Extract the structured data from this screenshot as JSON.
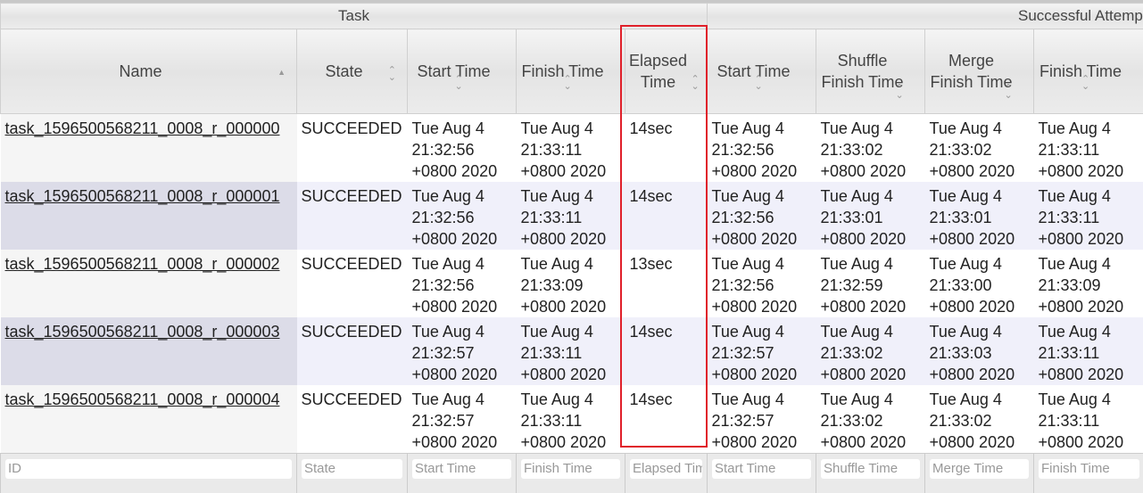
{
  "groups": [
    {
      "label": "Task"
    },
    {
      "label": "Successful Attempt"
    }
  ],
  "columns": [
    {
      "label": "Name",
      "sort": "asc"
    },
    {
      "label": "State",
      "sort": "both"
    },
    {
      "label": "Start Time",
      "sort": "both"
    },
    {
      "label": "Finish Time",
      "sort": "both"
    },
    {
      "label": "Elapsed\nTime",
      "sort": "both"
    },
    {
      "label": "Start Time",
      "sort": "both"
    },
    {
      "label": "Shuffle\nFinish Time",
      "sort": "both"
    },
    {
      "label": "Merge\nFinish Time",
      "sort": "both"
    },
    {
      "label": "Finish Time",
      "sort": "both"
    }
  ],
  "rows": [
    [
      "task_1596500568211_0008_r_000000",
      "SUCCEEDED",
      "Tue Aug 4\n21:32:56\n+0800 2020",
      "Tue Aug 4\n21:33:11\n+0800 2020",
      "14sec",
      "Tue Aug 4\n21:32:56\n+0800 2020",
      "Tue Aug 4\n21:33:02\n+0800 2020",
      "Tue Aug 4\n21:33:02\n+0800 2020",
      "Tue Aug 4\n21:33:11\n+0800 2020"
    ],
    [
      "task_1596500568211_0008_r_000001",
      "SUCCEEDED",
      "Tue Aug 4\n21:32:56\n+0800 2020",
      "Tue Aug 4\n21:33:11\n+0800 2020",
      "14sec",
      "Tue Aug 4\n21:32:56\n+0800 2020",
      "Tue Aug 4\n21:33:01\n+0800 2020",
      "Tue Aug 4\n21:33:01\n+0800 2020",
      "Tue Aug 4\n21:33:11\n+0800 2020"
    ],
    [
      "task_1596500568211_0008_r_000002",
      "SUCCEEDED",
      "Tue Aug 4\n21:32:56\n+0800 2020",
      "Tue Aug 4\n21:33:09\n+0800 2020",
      "13sec",
      "Tue Aug 4\n21:32:56\n+0800 2020",
      "Tue Aug 4\n21:32:59\n+0800 2020",
      "Tue Aug 4\n21:33:00\n+0800 2020",
      "Tue Aug 4\n21:33:09\n+0800 2020"
    ],
    [
      "task_1596500568211_0008_r_000003",
      "SUCCEEDED",
      "Tue Aug 4\n21:32:57\n+0800 2020",
      "Tue Aug 4\n21:33:11\n+0800 2020",
      "14sec",
      "Tue Aug 4\n21:32:57\n+0800 2020",
      "Tue Aug 4\n21:33:02\n+0800 2020",
      "Tue Aug 4\n21:33:03\n+0800 2020",
      "Tue Aug 4\n21:33:11\n+0800 2020"
    ],
    [
      "task_1596500568211_0008_r_000004",
      "SUCCEEDED",
      "Tue Aug 4\n21:32:57\n+0800 2020",
      "Tue Aug 4\n21:33:11\n+0800 2020",
      "14sec",
      "Tue Aug 4\n21:32:57\n+0800 2020",
      "Tue Aug 4\n21:33:02\n+0800 2020",
      "Tue Aug 4\n21:33:02\n+0800 2020",
      "Tue Aug 4\n21:33:11\n+0800 2020"
    ]
  ],
  "filters": [
    "ID",
    "State",
    "Start Time",
    "Finish Time",
    "Elapsed Time",
    "Start Time",
    "Shuffle Time",
    "Merge Time",
    "Finish Time"
  ],
  "colors": {
    "highlight": "#e0202a",
    "odd_row": "#f0f0fa",
    "sorted_col_odd": "#dcdce8"
  }
}
